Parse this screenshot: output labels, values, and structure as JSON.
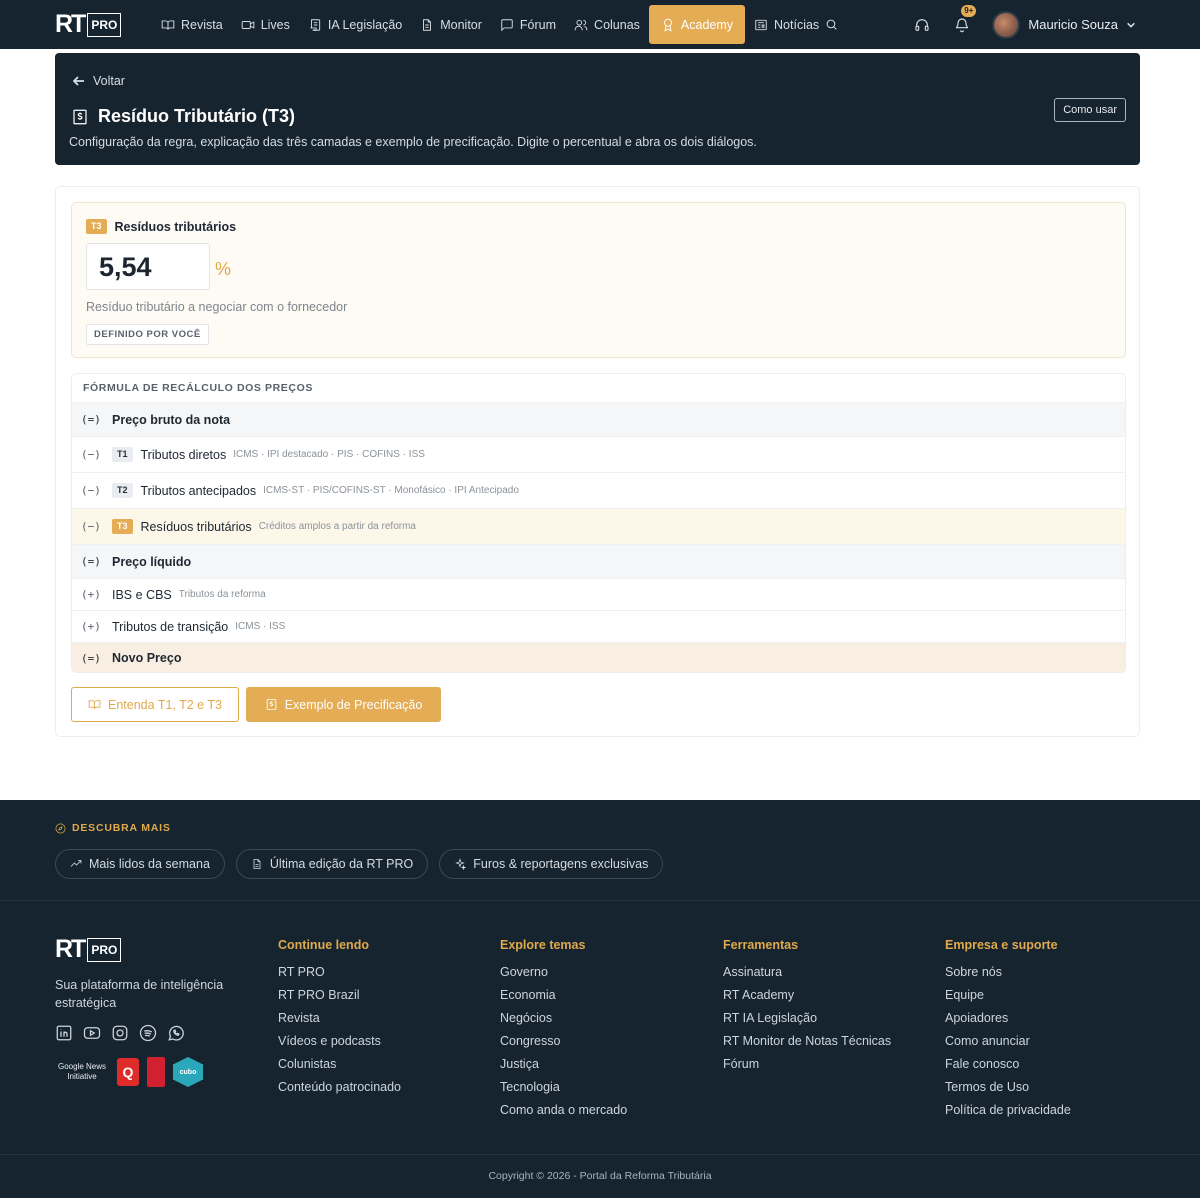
{
  "brand": {
    "rt": "RT",
    "pro": "PRO"
  },
  "nav": {
    "items": [
      {
        "label": "Revista",
        "icon": "book-open-icon"
      },
      {
        "label": "Lives",
        "icon": "video-icon"
      },
      {
        "label": "IA Legislação",
        "icon": "scroll-icon"
      },
      {
        "label": "Monitor",
        "icon": "file-text-icon"
      },
      {
        "label": "Fórum",
        "icon": "message-square-icon"
      },
      {
        "label": "Colunas",
        "icon": "users-icon"
      },
      {
        "label": "Academy",
        "icon": "award-icon",
        "active": true
      },
      {
        "label": "Notícias",
        "icon": "newspaper-icon"
      }
    ],
    "notifications_badge": "9+",
    "user_name": "Mauricio Souza"
  },
  "hero": {
    "back_label": "Voltar",
    "title": "Resíduo Tributário (T3)",
    "subtitle": "Configuração da regra, explicação das três camadas e exemplo de precificação. Digite o percentual e abra os dois diálogos.",
    "how_to_label": "Como usar"
  },
  "t3": {
    "tag": "T3",
    "heading": "Resíduos tributários",
    "value": "5,54",
    "unit": "%",
    "description": "Resíduo tributário a negociar com o fornecedor",
    "defined_by": "DEFINIDO POR VOCÊ"
  },
  "formula": {
    "title": "FÓRMULA DE RECÁLCULO DOS PREÇOS",
    "rows": [
      {
        "op": "(=)",
        "label": "Preço bruto da nota",
        "sub": "",
        "tag": "",
        "kind": "sum"
      },
      {
        "op": "(−)",
        "label": "Tributos diretos",
        "sub": "ICMS · IPI destacado · PIS · COFINS · ISS",
        "tag": "T1",
        "kind": "item"
      },
      {
        "op": "(−)",
        "label": "Tributos antecipados",
        "sub": "ICMS-ST · PIS/COFINS-ST · Monofásico · IPI Antecipado",
        "tag": "T2",
        "kind": "item"
      },
      {
        "op": "(−)",
        "label": "Resíduos tributários",
        "sub": "Créditos amplos a partir da reforma",
        "tag": "T3",
        "kind": "t3"
      },
      {
        "op": "(=)",
        "label": "Preço líquido",
        "sub": "",
        "tag": "",
        "kind": "sum"
      },
      {
        "op": "(+)",
        "label": "IBS e CBS",
        "sub": "Tributos da reforma",
        "tag": "",
        "kind": "item"
      },
      {
        "op": "(+)",
        "label": "Tributos de transição",
        "sub": "ICMS · ISS",
        "tag": "",
        "kind": "item"
      },
      {
        "op": "(=)",
        "label": "Novo Preço",
        "sub": "",
        "tag": "",
        "kind": "final"
      }
    ]
  },
  "actions": {
    "understand_label": "Entenda T1, T2 e T3",
    "example_label": "Exemplo de Precificação"
  },
  "footer": {
    "discover_title": "DESCUBRA MAIS",
    "pills": [
      {
        "label": "Mais lidos da semana",
        "icon": "trending-up-icon"
      },
      {
        "label": "Última edição da RT PRO",
        "icon": "file-icon"
      },
      {
        "label": "Furos & reportagens exclusivas",
        "icon": "sparkles-icon"
      }
    ],
    "tagline": "Sua plataforma de inteligência estratégica",
    "google_news": "Google News Initiative",
    "cubo": "cubo",
    "q_label": "Q",
    "columns": [
      {
        "title": "Continue lendo",
        "links": [
          "RT PRO",
          "RT PRO Brazil",
          "Revista",
          "Vídeos e podcasts",
          "Colunistas",
          "Conteúdo patrocinado"
        ]
      },
      {
        "title": "Explore temas",
        "links": [
          "Governo",
          "Economia",
          "Negócios",
          "Congresso",
          "Justiça",
          "Tecnologia",
          "Como anda o mercado"
        ]
      },
      {
        "title": "Ferramentas",
        "links": [
          "Assinatura",
          "RT Academy",
          "RT IA Legislação",
          "RT Monitor de Notas Técnicas",
          "Fórum"
        ]
      },
      {
        "title": "Empresa e suporte",
        "links": [
          "Sobre nós",
          "Equipe",
          "Apoiadores",
          "Como anunciar",
          "Fale conosco",
          "Termos de Uso",
          "Política de privacidade"
        ]
      }
    ],
    "copyright": "Copyright © 2026 - Portal da Reforma Tributária"
  },
  "colors": {
    "navy": "#16242f",
    "gold": "#e4ac55"
  }
}
